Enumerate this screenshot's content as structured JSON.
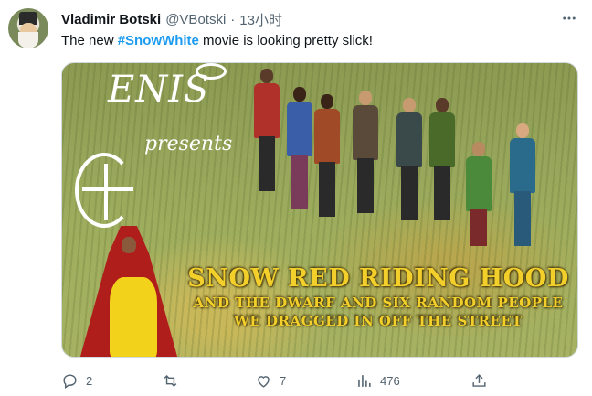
{
  "tweet": {
    "display_name": "Vladimir Botski",
    "handle": "@VBotski",
    "separator": "·",
    "timestamp": "13小时",
    "text_before": "The new ",
    "hashtag": "#SnowWhite",
    "text_after": " movie is looking pretty slick!"
  },
  "media": {
    "logo_text": "ENIS",
    "presents_text": "presents",
    "title_line1": "SNOW RED RIDING HOOD",
    "title_line2": "AND THE DWARF AND SIX RANDOM PEOPLE",
    "title_line3": "WE DRAGGED IN OFF THE STREET"
  },
  "actions": {
    "reply_count": "2",
    "retweet_count": "",
    "like_count": "7",
    "views_count": "476"
  },
  "colors": {
    "accent": "#1d9bf0",
    "muted": "#536471",
    "title_gold": "#f2cf2b"
  },
  "icons": [
    "more-icon",
    "reply-icon",
    "retweet-icon",
    "like-icon",
    "views-icon",
    "share-icon"
  ]
}
